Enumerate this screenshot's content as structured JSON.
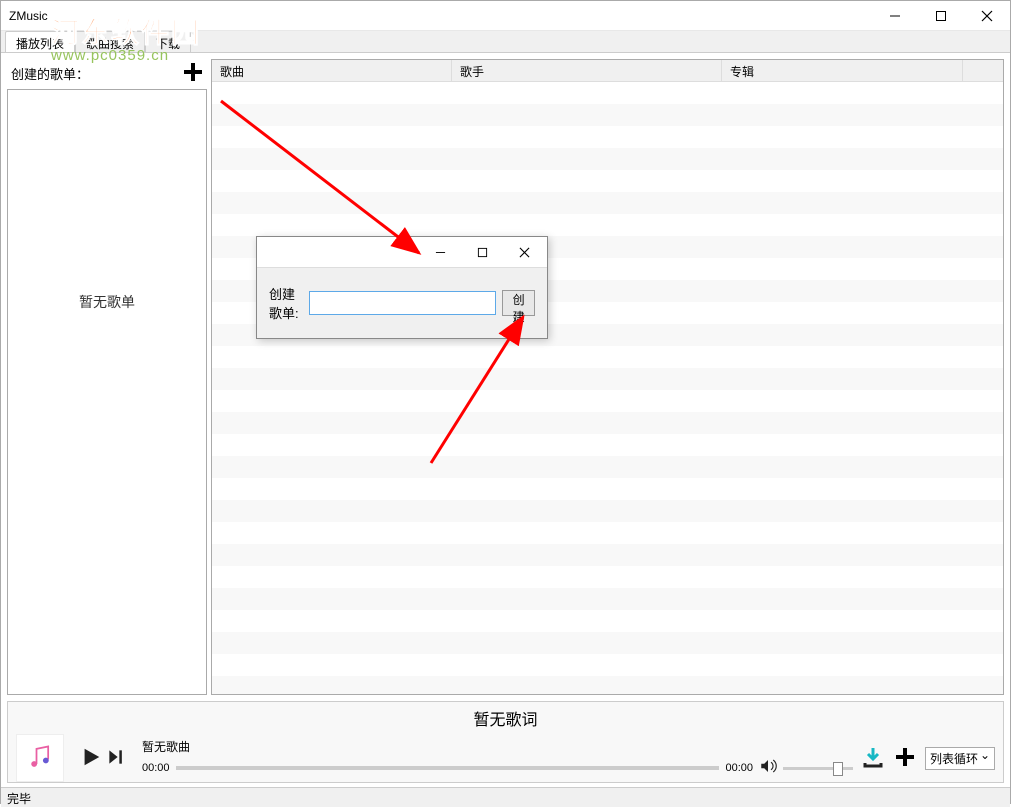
{
  "window": {
    "title": "ZMusic"
  },
  "watermark": {
    "line1": "河东软件园",
    "line2": "www.pc0359.cn"
  },
  "menu": {
    "tab_playlist": "播放列表",
    "tab_search": "歌曲搜索",
    "tab_download": "下载"
  },
  "sidebar": {
    "header_label": "创建的歌单：",
    "empty_text": "暂无歌单"
  },
  "table": {
    "col_song": "歌曲",
    "col_artist": "歌手",
    "col_album": "专辑"
  },
  "player": {
    "lyrics_empty": "暂无歌词",
    "track_empty": "暂无歌曲",
    "time_current": "00:00",
    "time_total": "00:00",
    "loop_mode": "列表循环"
  },
  "dialog": {
    "label": "创建歌单:",
    "button": "创建",
    "input_value": ""
  },
  "status": {
    "text": "完毕"
  }
}
